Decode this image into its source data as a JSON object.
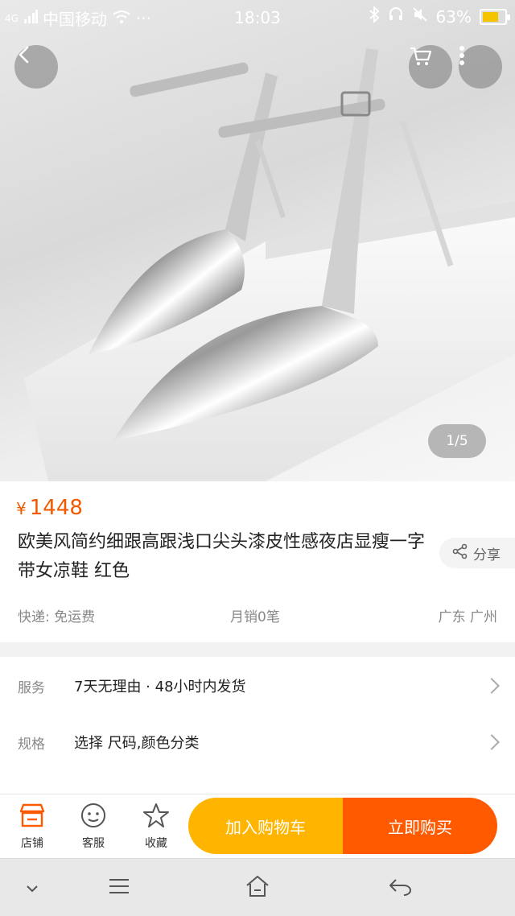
{
  "status_bar": {
    "network_type": "4G",
    "carrier": "中国移动",
    "more_dots": "···",
    "time": "18:03",
    "battery": "63%"
  },
  "gallery": {
    "pager": "1/5",
    "back_icon": "chevron-left-icon",
    "cart_icon": "cart-icon",
    "more_icon": "more-vertical-icon"
  },
  "product": {
    "currency": "¥",
    "price": "1448",
    "title": "欧美风简约细跟高跟浅口尖头漆皮性感夜店显瘦一字带女凉鞋 红色",
    "share_label": "分享",
    "shipping": "快递: 免运费",
    "monthly_sales": "月销0笔",
    "location": "广东 广州"
  },
  "options": [
    {
      "key": "服务",
      "value": "7天无理由 · 48小时内发货"
    },
    {
      "key": "规格",
      "value": "选择 尺码,颜色分类"
    }
  ],
  "action_bar": {
    "store_label": "店铺",
    "service_label": "客服",
    "favorite_label": "收藏",
    "add_to_cart_label": "加入购物车",
    "buy_now_label": "立即购买"
  },
  "colors": {
    "price": "#f25a00",
    "cart_button": "#ffb400",
    "buy_button": "#ff5a00",
    "store_icon": "#ff5a00"
  }
}
